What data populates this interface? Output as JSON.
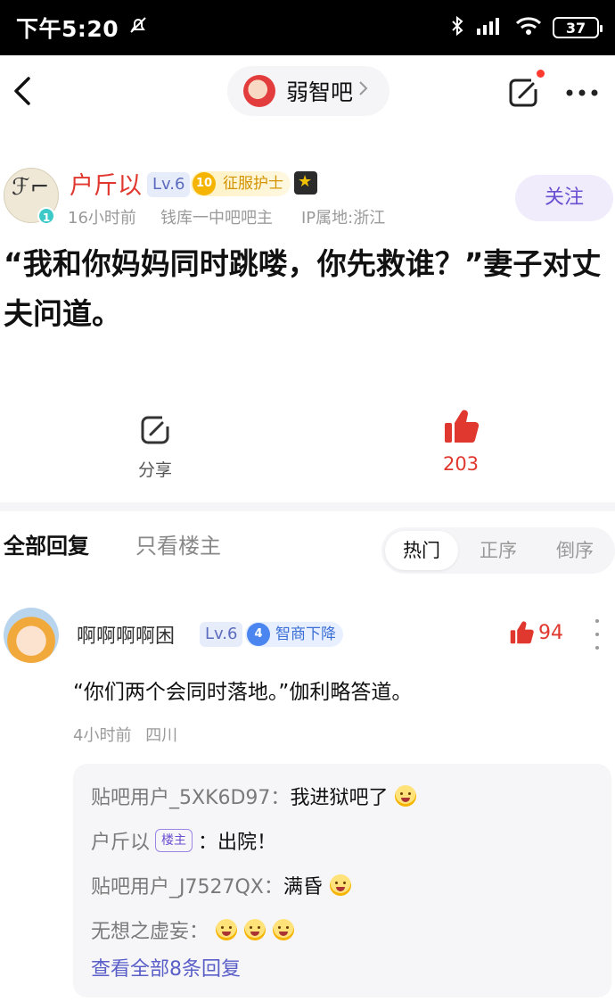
{
  "status_bar": {
    "time": "下午5:20",
    "battery": "37",
    "icons": [
      "mute-bell-icon",
      "bluetooth-icon",
      "signal-icon",
      "wifi-icon",
      "battery-icon"
    ]
  },
  "topbar": {
    "forum_name": "弱智吧",
    "icons": [
      "back-icon",
      "chevron-right-icon",
      "edit-icon",
      "more-icon"
    ]
  },
  "post": {
    "author": {
      "name": "户斤以",
      "level": "Lv.6",
      "title_level": "10",
      "title": "征服护士",
      "avatar_badge": "1",
      "time": "16小时前",
      "role": "钱库一中吧吧主",
      "ip": "IP属地:浙江"
    },
    "follow_label": "关注",
    "title": "“我和你妈妈同时跳喽，你先救谁？”妻子对丈夫问道。",
    "share_label": "分享",
    "like_count": "203"
  },
  "tabs": {
    "all": "全部回复",
    "op_only": "只看楼主",
    "sort": [
      "热门",
      "正序",
      "倒序"
    ]
  },
  "comment": {
    "name": "啊啊啊啊困",
    "level": "Lv.6",
    "badge_num": "4",
    "badge_title": "智商下降",
    "likes": "94",
    "text": "“你们两个会同时落地。”伽利略答道。",
    "time": "4小时前",
    "location": "四川",
    "replies": [
      {
        "who": "贴吧用户_5XK6D97：",
        "text": "我进狱吧了"
      },
      {
        "who": "户斤以",
        "tag": "楼主",
        "text": "：出院！"
      },
      {
        "who": "贴吧用户_J7527QX：",
        "text": "满昏"
      },
      {
        "who": "无想之虚妄：",
        "text": ""
      }
    ],
    "view_all": "查看全部8条回复"
  },
  "colors": {
    "accent_red": "#e0382f",
    "accent_purple": "#6b4fd1",
    "link_blue": "#5a5fc8"
  }
}
